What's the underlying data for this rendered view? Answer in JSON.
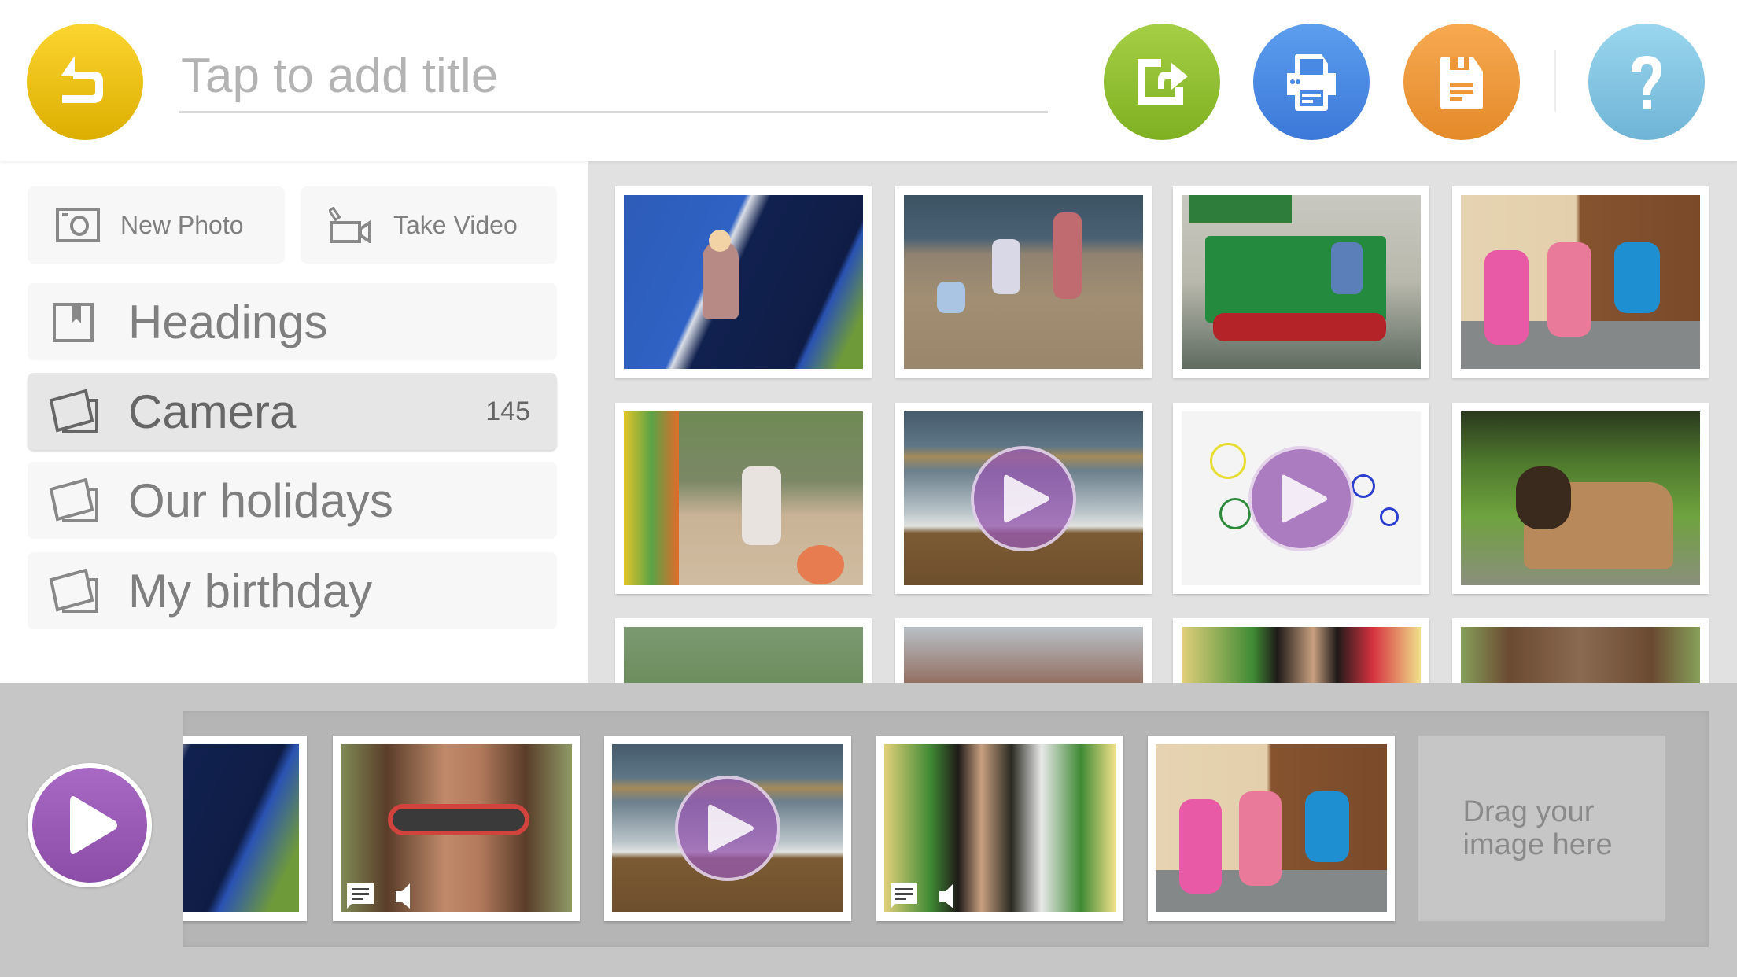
{
  "header": {
    "title_placeholder": "Tap to add title",
    "title_value": "",
    "buttons": {
      "back": {
        "icon": "undo-arrow-icon",
        "color": "#f2c40f"
      },
      "share": {
        "icon": "share-export-icon",
        "color": "#8cc030"
      },
      "print": {
        "icon": "printer-icon",
        "color": "#4a89e3"
      },
      "save": {
        "icon": "floppy-save-icon",
        "color": "#ee9838"
      },
      "help": {
        "icon": "question-mark-icon",
        "color": "#82c4e2",
        "glyph": "?"
      }
    }
  },
  "sidebar": {
    "actions": [
      {
        "label": "New Photo",
        "icon": "camera-icon"
      },
      {
        "label": "Take Video",
        "icon": "video-camera-icon"
      }
    ],
    "albums": [
      {
        "label": "Headings",
        "icon": "bookmark-icon",
        "count": null,
        "selected": false
      },
      {
        "label": "Camera",
        "icon": "photo-album-icon",
        "count": "145",
        "selected": true
      },
      {
        "label": "Our holidays",
        "icon": "photo-album-icon",
        "count": null,
        "selected": false
      },
      {
        "label": "My birthday",
        "icon": "photo-album-icon",
        "count": null,
        "selected": false
      }
    ]
  },
  "gallery": {
    "items": [
      {
        "subject": "child in blue tent",
        "type": "photo"
      },
      {
        "subject": "family on beach",
        "type": "photo"
      },
      {
        "subject": "child on toy train",
        "type": "photo"
      },
      {
        "subject": "three children on steps",
        "type": "photo"
      },
      {
        "subject": "child on swing",
        "type": "photo"
      },
      {
        "subject": "beach waves",
        "type": "video"
      },
      {
        "subject": "child's drawing",
        "type": "video"
      },
      {
        "subject": "dog in grass",
        "type": "photo"
      },
      {
        "subject": "trees",
        "type": "photo"
      },
      {
        "subject": "man in garden",
        "type": "photo"
      },
      {
        "subject": "man with glasses",
        "type": "photo"
      },
      {
        "subject": "girl with sunglasses",
        "type": "photo"
      }
    ]
  },
  "storyboard": {
    "play_button": "play-icon",
    "items": [
      {
        "subject": "child in blue tent",
        "type": "photo",
        "has_caption": false,
        "has_audio": false
      },
      {
        "subject": "girl with sunglasses",
        "type": "photo",
        "has_caption": true,
        "has_audio": true
      },
      {
        "subject": "beach waves",
        "type": "video",
        "has_caption": false,
        "has_audio": false
      },
      {
        "subject": "man holding baby",
        "type": "photo",
        "has_caption": true,
        "has_audio": true
      },
      {
        "subject": "three children on steps",
        "type": "photo",
        "has_caption": false,
        "has_audio": false
      }
    ],
    "dropzone_label": "Drag your image here"
  }
}
